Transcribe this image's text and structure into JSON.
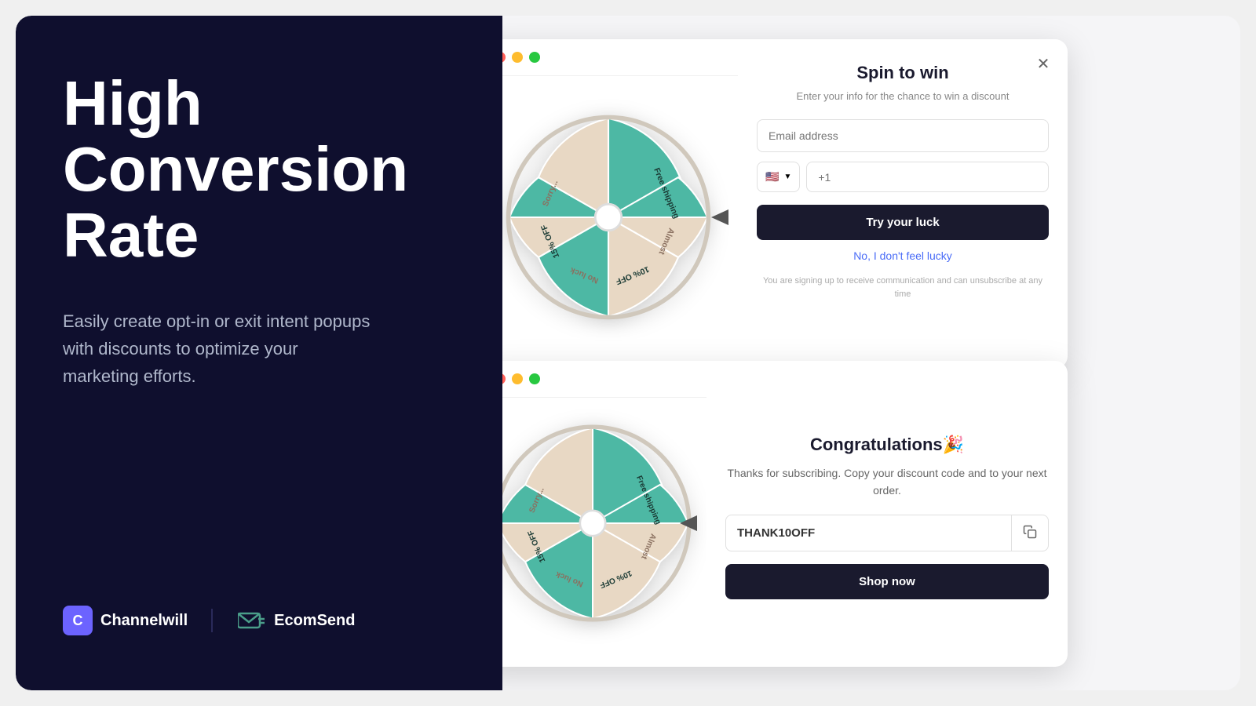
{
  "left": {
    "title_line1": "High",
    "title_line2": "Conversion",
    "title_line3": "Rate",
    "subtitle": "Easily create opt-in or exit intent popups with discounts to optimize your marketing efforts.",
    "brand1_name": "Channelwill",
    "brand1_icon": "C",
    "brand2_name": "EcomSend"
  },
  "popup_top": {
    "title": "Spin to win",
    "subtitle": "Enter your info for the chance to win a discount",
    "email_placeholder": "Email address",
    "phone_placeholder": "+1",
    "flag": "🇺🇸",
    "cta_label": "Try your luck",
    "no_luck_label": "No, I don't feel lucky",
    "disclaimer": "You are signing up to receive communication and can unsubscribe at any time"
  },
  "popup_bottom": {
    "title": "Congratulations🎉",
    "text": "Thanks for subscribing. Copy your discount code and to your next order.",
    "discount_code": "THANK10OFF",
    "shop_now_label": "Shop now"
  },
  "wheel": {
    "segments": [
      {
        "label": "Free shipping",
        "color": "#4db8a4"
      },
      {
        "label": "Almost",
        "color": "#e8d8c4"
      },
      {
        "label": "10% OFF",
        "color": "#4db8a4"
      },
      {
        "label": "No luck",
        "color": "#e8d8c4"
      },
      {
        "label": "15% OFF",
        "color": "#4db8a4"
      },
      {
        "label": "Sorry...",
        "color": "#e8d8c4"
      },
      {
        "label": "Sorry...",
        "color": "#4db8a4"
      },
      {
        "label": "Sorry...",
        "color": "#e8d8c4"
      }
    ]
  },
  "window_controls": {
    "red": "#ff5f57",
    "yellow": "#febc2e",
    "green": "#28c840"
  }
}
